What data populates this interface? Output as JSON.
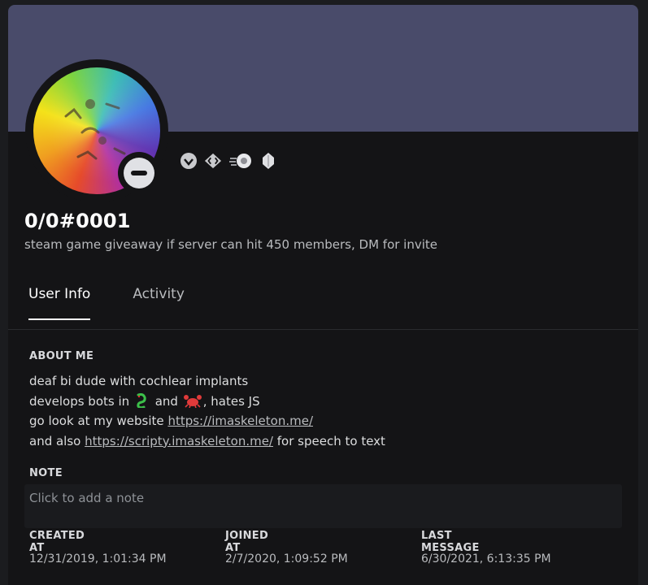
{
  "user": {
    "username": "0/0#0001",
    "custom_status": "steam game giveaway if server can hit 450 members, DM for invite"
  },
  "badges": [
    "hypesquad-badge-icon",
    "developer-badge-icon",
    "boost-badge-icon",
    "nitro-gem-badge-icon"
  ],
  "tabs": [
    {
      "label": "User Info",
      "active": true
    },
    {
      "label": "Activity",
      "active": false
    }
  ],
  "about": {
    "title": "ABOUT ME",
    "line1": "deaf bi dude with cochlear implants",
    "line2_before": "develops bots in",
    "line2_middle": "and",
    "line2_after": ", hates JS",
    "line3_before": "go look at my website",
    "link1": "https://imaskeleton.me/",
    "line4_before": "and also",
    "link2": "https://scripty.imaskeleton.me/",
    "line4_after": "for speech to text"
  },
  "note": {
    "title": "NOTE",
    "placeholder": "Click to add a note"
  },
  "meta": {
    "created_label": "CREATED AT",
    "created_value": "12/31/2019, 1:01:34 PM",
    "joined_label": "JOINED AT",
    "joined_value": "2/7/2020, 1:09:52 PM",
    "last_message_label": "LAST MESSAGE",
    "last_message_value": "6/30/2021, 6:13:35 PM"
  },
  "colors": {
    "banner": "#494b6a",
    "card": "#141416",
    "status_dnd": "#e0e1e5"
  }
}
